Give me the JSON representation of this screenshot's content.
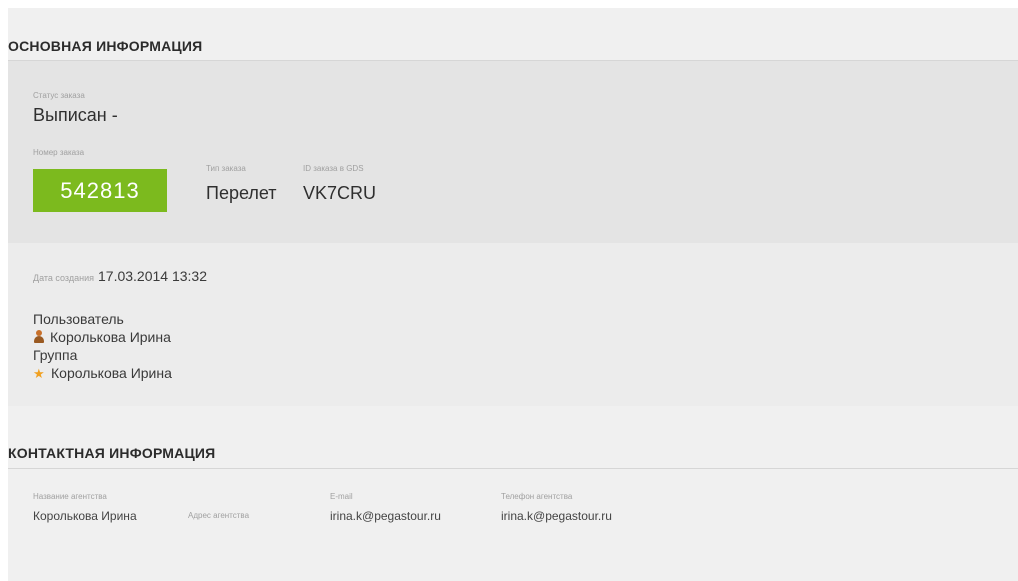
{
  "sections": {
    "main_title": "ОСНОВНАЯ ИНФОРМАЦИЯ",
    "contact_title": "КОНТАКТНАЯ ИНФОРМАЦИЯ"
  },
  "order": {
    "status_label": "Статус заказа",
    "status_value": "Выписан -",
    "number_label": "Номер заказа",
    "number_value": "542813",
    "type_label": "Тип заказа",
    "type_value": "Перелет",
    "gds_label": "ID заказа в GDS",
    "gds_value": "VK7CRU",
    "accent_color": "#7cba1e"
  },
  "meta": {
    "created_label": "Дата создания",
    "created_value": "17.03.2014 13:32",
    "user_label": "Пользователь",
    "user_value": "Корольк­ова Ирина",
    "user_icon": "user-icon",
    "group_label": "Группа",
    "group_value": "Королькова Ирина",
    "group_icon": "star-icon"
  },
  "contact": {
    "agency_name_label": "Название агентства",
    "agency_name_value": "Королькова Ирина",
    "agency_address_label": "Адрес агентства",
    "email_label": "E-mail",
    "email_value": "irina.k@pegastour.ru",
    "phone_label": "Телефон агентства",
    "phone_value": "irina.k@pegastour.ru"
  }
}
